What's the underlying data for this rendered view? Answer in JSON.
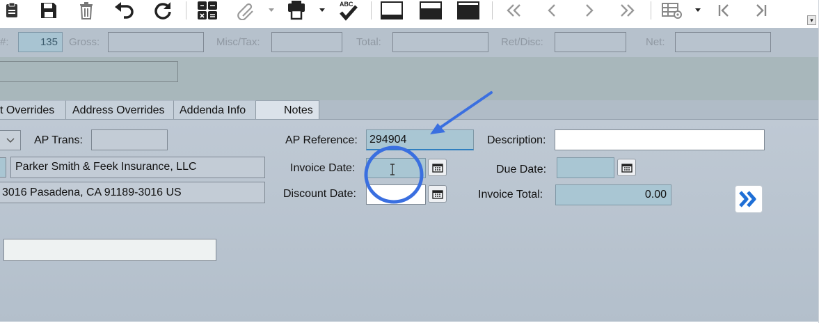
{
  "toolbar": {
    "icons": [
      "notes-icon",
      "save-icon",
      "delete-icon",
      "undo-icon",
      "refresh-icon",
      "calculator-icon",
      "attachment-icon",
      "print-icon",
      "spell-check-icon",
      "layout-bottom-icon",
      "layout-middle-icon",
      "layout-top-icon",
      "first-record-icon",
      "previous-record-icon",
      "next-record-icon",
      "last-record-icon",
      "grid-settings-icon",
      "jump-first-icon",
      "jump-last-icon"
    ],
    "spellcheck_badge": "ABC"
  },
  "summary": {
    "count_label_fragment": "#:",
    "count_value": "135",
    "gross_label": "Gross:",
    "gross_value": "",
    "misc_tax_label": "Misc/Tax:",
    "misc_tax_value": "",
    "total_label": "Total:",
    "total_value": "",
    "ret_disc_label": "Ret/Disc:",
    "ret_disc_value": "",
    "net_label": "Net:",
    "net_value": ""
  },
  "header": {
    "field_value": ""
  },
  "tabs": [
    {
      "label": "t Overrides",
      "active": false
    },
    {
      "label": "Address Overrides",
      "active": false
    },
    {
      "label": "Addenda Info",
      "active": false
    },
    {
      "label": "Notes",
      "active": true
    }
  ],
  "form": {
    "ap_trans_label": "AP Trans:",
    "ap_trans_value": "",
    "vendor_name": "Parker Smith & Feek Insurance, LLC",
    "vendor_address": "3016  Pasadena, CA  91189-3016  US",
    "ap_reference_label": "AP Reference:",
    "ap_reference_value": "294904",
    "invoice_date_label": "Invoice Date:",
    "invoice_date_value": "",
    "discount_date_label": "Discount Date:",
    "discount_date_value": "",
    "description_label": "Description:",
    "description_value": "",
    "due_date_label": "Due Date:",
    "due_date_value": "",
    "invoice_total_label": "Invoice Total:",
    "invoice_total_value": "0.00",
    "lower_field_value": ""
  },
  "annotation": {
    "color": "#3a6fe0"
  },
  "colors": {
    "accent_blue": "#1f6fd6",
    "field_blue": "#a9c6d3"
  }
}
